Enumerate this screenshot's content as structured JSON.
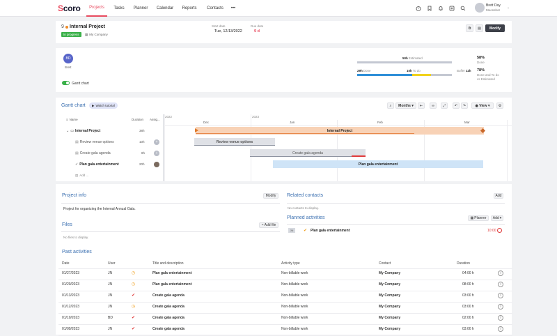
{
  "app": {
    "logo_first": "S",
    "logo_rest": "coro"
  },
  "nav": [
    "Projects",
    "Tasks",
    "Planner",
    "Calendar",
    "Reports",
    "Contacts",
    "•••"
  ],
  "user": {
    "name": "Brett Day",
    "company": "Moonshot"
  },
  "project": {
    "number": "9",
    "title": "Internal Project",
    "status": "In progress",
    "company": "My Company",
    "start_label": "Start date",
    "start_value": "Tue, 12/13/2022",
    "due_label": "Due date",
    "due_value": "9 d",
    "modify": "Modify",
    "avatar": "BD",
    "avatar_name": "Brett",
    "gantt_toggle": "Gantt chart",
    "estimated": "50h",
    "estimated_label": "Estimated",
    "done": "29h",
    "done_label": "Done",
    "todo": "10h",
    "todo_label": "To do",
    "buffer_label": "Buffer",
    "buffer": "11h",
    "pct_done": "58%",
    "pct_done_label": "Done",
    "pct_total": "78%",
    "pct_total_label1": "Done and To do",
    "pct_total_label2": "vs Estimated",
    "progress": {
      "done": 0.58,
      "todo": 0.2
    }
  },
  "gantt": {
    "title": "Gantt chart",
    "tutorial": "Watch tutorial",
    "months_btn": "Months",
    "view_btn": "View",
    "col_name": "Name",
    "col_duration": "Duration",
    "col_assign": "Assig...",
    "year1": "2022",
    "year2": "2023",
    "months": [
      "Dec",
      "Jan",
      "Feb",
      "Mar"
    ],
    "rows": [
      {
        "name": "Internal Project",
        "duration": "38h"
      },
      {
        "name": "Review venue options",
        "duration": "10h"
      },
      {
        "name": "Create gala agenda",
        "duration": "8h"
      },
      {
        "name": "Plan gala entertainment",
        "duration": "20h"
      }
    ],
    "add": "Add ..."
  },
  "project_info": {
    "title": "Project info",
    "modify": "Modify",
    "text": "Project for organizing the Internal Annual Gala."
  },
  "files": {
    "title": "Files",
    "add": "Add file",
    "empty": "No files to display."
  },
  "related": {
    "title": "Related contacts",
    "add": "Add",
    "empty": "No contacts to display."
  },
  "planned": {
    "title": "Planned activities",
    "planner": "Planner",
    "add": "Add",
    "item_badge": "JN",
    "item_title": "Plan gala entertainment",
    "item_time": "10:00"
  },
  "past": {
    "title": "Past activities",
    "headers": [
      "Date",
      "User",
      "Title and description",
      "Activity type",
      "Contact",
      "Duration"
    ],
    "rows": [
      {
        "date": "01/27/2023",
        "user": "JN",
        "title": "Plan gala entertainment",
        "type": "Non-billable work",
        "contact": "My Company",
        "duration": "04:00 h",
        "icon": "clock-icon"
      },
      {
        "date": "01/20/2023",
        "user": "JN",
        "title": "Plan gala entertainment",
        "type": "Non-billable work",
        "contact": "My Company",
        "duration": "08:00 h",
        "icon": "clock-icon"
      },
      {
        "date": "01/13/2023",
        "user": "JN",
        "title": "Create gala agenda",
        "type": "Non-billable work",
        "contact": "My Company",
        "duration": "03:00 h",
        "icon": "check-icon"
      },
      {
        "date": "01/12/2023",
        "user": "JN",
        "title": "Create gala agenda",
        "type": "Non-billable work",
        "contact": "My Company",
        "duration": "03:00 h",
        "icon": "clock-icon"
      },
      {
        "date": "01/10/2023",
        "user": "BD",
        "title": "Create gala agenda",
        "type": "Non-billable work",
        "contact": "My Company",
        "duration": "02:00 h",
        "icon": "check-icon"
      },
      {
        "date": "01/09/2023",
        "user": "JN",
        "title": "Create gala agenda",
        "type": "Non-billable work",
        "contact": "My Company",
        "duration": "03:00 h",
        "icon": "check-icon"
      }
    ]
  },
  "colors": {
    "accent": "#e84a5f",
    "done": "#2f8fd8",
    "todo": "#f1d21c",
    "estimated": "#c4c8d2",
    "status": "#3bb14a",
    "gantt_project": "#f8d2b6",
    "gantt_task": "#dfe1e6",
    "gantt_active": "#cfe4f7"
  }
}
